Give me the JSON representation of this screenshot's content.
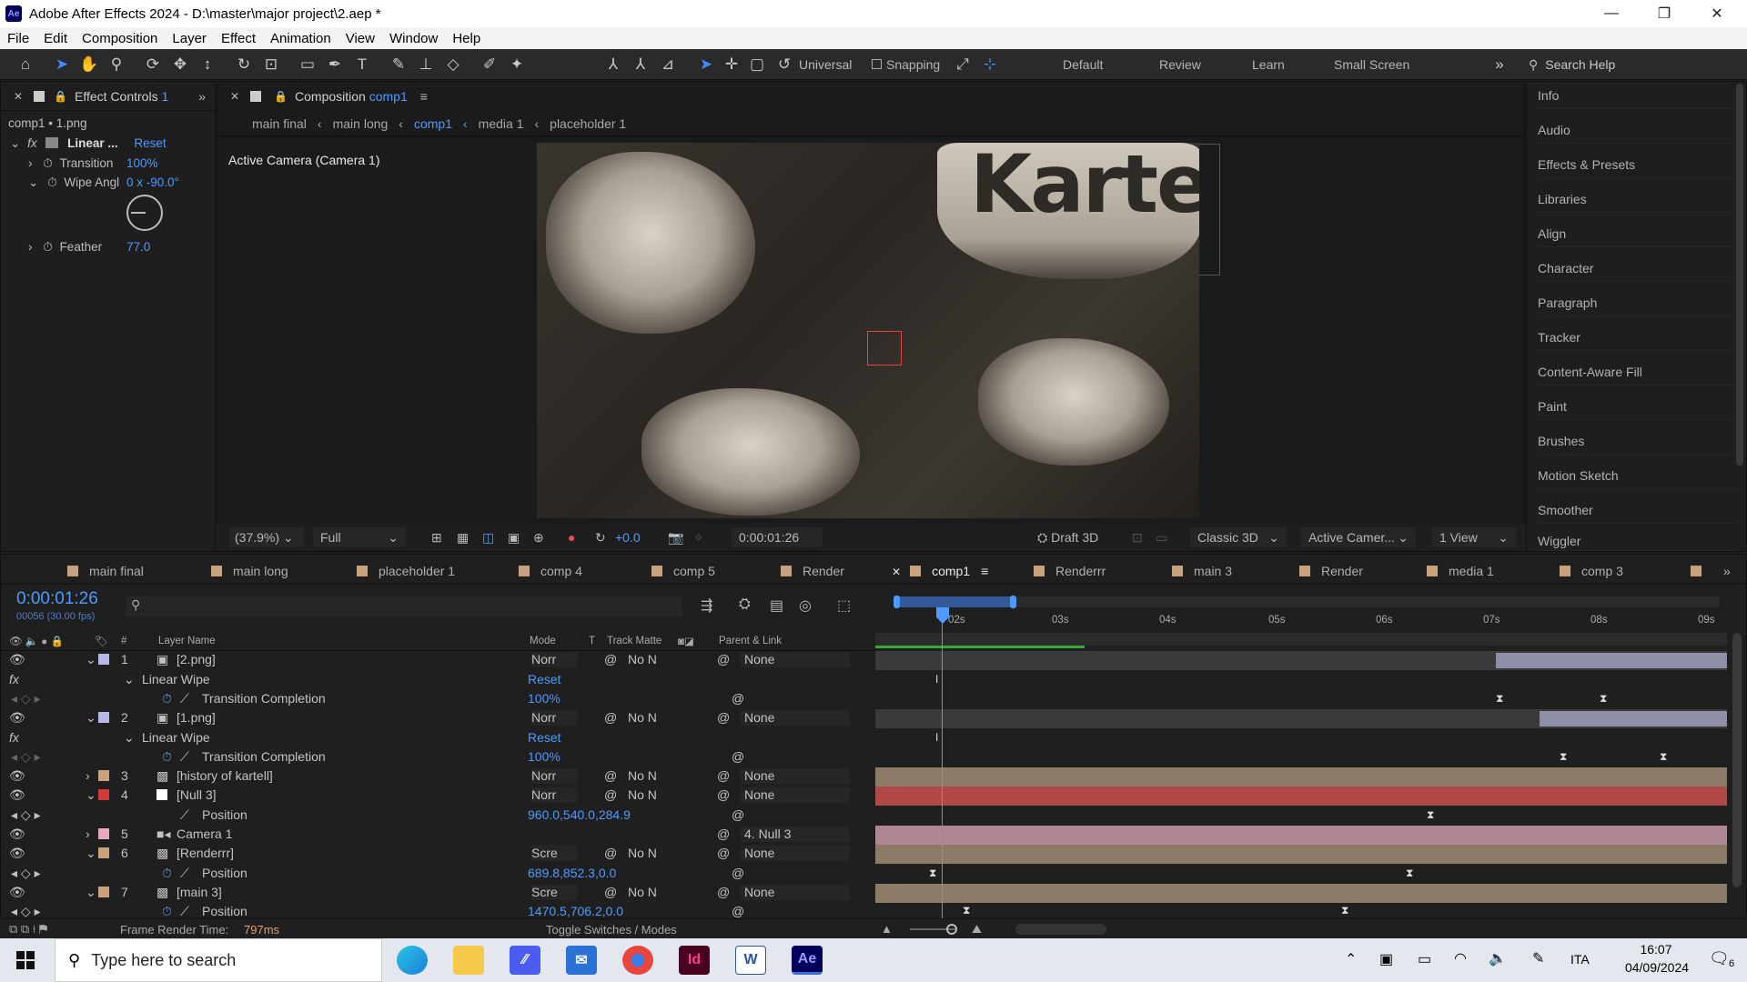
{
  "window": {
    "title": "Adobe After Effects 2024 - D:\\master\\major project\\2.aep *",
    "logo": "Ae",
    "controls": [
      "—",
      "❐",
      "✕"
    ]
  },
  "menu": [
    "File",
    "Edit",
    "Composition",
    "Layer",
    "Effect",
    "Animation",
    "View",
    "Window",
    "Help"
  ],
  "toolbar": {
    "universal_label": "Universal",
    "snapping_label": "Snapping",
    "workspaces": [
      "Default",
      "Review",
      "Learn",
      "Small Screen"
    ],
    "search_placeholder": "Search Help"
  },
  "effect_controls": {
    "tab_label": "Effect Controls",
    "tab_target": "1",
    "subtitle": "comp1 • 1.png",
    "effect_name": "Linear ...",
    "reset": "Reset",
    "props": [
      {
        "name": "Transition",
        "value": "100",
        "unit": "%"
      },
      {
        "name": "Wipe Angl",
        "value": "0 x -90.0°"
      },
      {
        "name": "Feather",
        "value": "77.0"
      }
    ]
  },
  "composition": {
    "tab_label": "Composition",
    "tab_target": "comp1",
    "breadcrumbs": [
      "main final",
      "main long",
      "comp1",
      "media 1",
      "placeholder 1"
    ],
    "camera_label": "Active Camera (Camera 1)",
    "brand_text": "Kartel",
    "footer": {
      "zoom": "(37.9%)",
      "quality": "Full",
      "exposure": "+0.0",
      "timecode": "0:00:01:26",
      "draft3d": "Draft 3D",
      "renderer": "Classic 3D",
      "camera": "Active Camer...",
      "views": "1 View"
    }
  },
  "right_panel": [
    "Info",
    "Audio",
    "Effects & Presets",
    "Libraries",
    "Align",
    "Character",
    "Paragraph",
    "Tracker",
    "Content-Aware Fill",
    "Paint",
    "Brushes",
    "Motion Sketch",
    "Smoother",
    "Wiggler"
  ],
  "timeline": {
    "tabs": [
      {
        "label": "main final",
        "color": "#c9a27d"
      },
      {
        "label": "main long",
        "color": "#c9a27d"
      },
      {
        "label": "placeholder 1",
        "color": "#c9a27d"
      },
      {
        "label": "comp 4",
        "color": "#c9a27d"
      },
      {
        "label": "comp 5",
        "color": "#c9a27d"
      },
      {
        "label": "Render",
        "color": "#c9a27d"
      },
      {
        "label": "comp1",
        "color": "#c9a27d"
      },
      {
        "label": "Renderrr",
        "color": "#c9a27d"
      },
      {
        "label": "main 3",
        "color": "#c9a27d"
      },
      {
        "label": "Render",
        "color": "#c9a27d"
      },
      {
        "label": "media 1",
        "color": "#c9a27d"
      },
      {
        "label": "comp 3",
        "color": "#c9a27d"
      }
    ],
    "timecode": "0:00:01:26",
    "frames": "00056 (30.00 fps)",
    "columns": {
      "layer_name": "Layer Name",
      "mode": "Mode",
      "t": "T",
      "track_matte": "Track Matte",
      "parent": "Parent & Link"
    },
    "ruler": [
      "02s",
      "03s",
      "04s",
      "05s",
      "06s",
      "07s",
      "08s",
      "09s"
    ],
    "rows": [
      {
        "type": "layer",
        "num": "1",
        "name": "[2.png]",
        "label": "#b7b7e8",
        "mode": "Norr",
        "matte": "No N",
        "parent": "None",
        "bar": "#8e8ea8"
      },
      {
        "type": "effect",
        "name": "Linear Wipe",
        "value": "Reset"
      },
      {
        "type": "prop",
        "name": "Transition Completion",
        "value": "100",
        "unit": "%"
      },
      {
        "type": "layer",
        "num": "2",
        "name": "[1.png]",
        "label": "#b7b7e8",
        "mode": "Norr",
        "matte": "No N",
        "parent": "None",
        "bar": "#8e8ea8"
      },
      {
        "type": "effect",
        "name": "Linear Wipe",
        "value": "Reset"
      },
      {
        "type": "prop",
        "name": "Transition Completion",
        "value": "100",
        "unit": "%"
      },
      {
        "type": "layer",
        "num": "3",
        "name": "[history of kartell]",
        "label": "#c9a27d",
        "mode": "Norr",
        "matte": "No N",
        "parent": "None",
        "bar": "#8c7b66"
      },
      {
        "type": "layer",
        "num": "4",
        "name": "[Null 3]",
        "label": "#d43a3a",
        "mode": "Norr",
        "matte": "No N",
        "parent": "None",
        "bar": "#b04848"
      },
      {
        "type": "prop",
        "name": "Position",
        "value": "960.0,540.0,284.9"
      },
      {
        "type": "layer",
        "num": "5",
        "name": "Camera 1",
        "label": "#e8a8c0",
        "mode": "",
        "matte": "",
        "parent": "4. Null 3",
        "bar": "#b08696"
      },
      {
        "type": "layer",
        "num": "6",
        "name": "[Renderrr]",
        "label": "#c9a27d",
        "mode": "Scre",
        "matte": "No N",
        "parent": "None",
        "bar": "#8c7b66"
      },
      {
        "type": "prop",
        "name": "Position",
        "value": "689.8,852.3,0.0"
      },
      {
        "type": "layer",
        "num": "7",
        "name": "[main 3]",
        "label": "#c9a27d",
        "mode": "Scre",
        "matte": "No N",
        "parent": "None",
        "bar": "#8c7b66"
      },
      {
        "type": "prop",
        "name": "Position",
        "value": "1470.5,706.2,0.0"
      }
    ],
    "footer": {
      "render_label": "Frame Render Time:",
      "render_value": "797ms",
      "toggle": "Toggle Switches / Modes"
    }
  },
  "taskbar": {
    "search_placeholder": "Type here to search",
    "lang": "ITA",
    "time": "16:07",
    "date": "04/09/2024",
    "notif": "6",
    "apps": [
      "Edge",
      "Explorer",
      "Ps-like",
      "Mail",
      "Chrome",
      "InDesign",
      "Word",
      "After Effects"
    ],
    "app_labels": {
      "indesign": "Id",
      "word": "W",
      "ae": "Ae"
    }
  }
}
